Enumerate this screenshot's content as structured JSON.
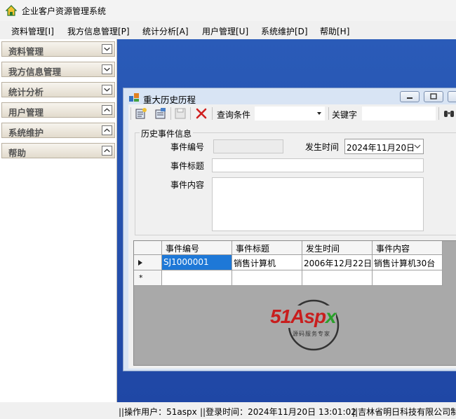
{
  "app": {
    "title": "企业客户资源管理系统"
  },
  "menu": [
    "资料管理[I]",
    "我方信息管理[P]",
    "统计分析[A]",
    "用户管理[U]",
    "系统维护[D]",
    "帮助[H]"
  ],
  "sidebar": {
    "items": [
      "资料管理",
      "我方信息管理",
      "统计分析",
      "用户管理",
      "系统维护",
      "帮助"
    ]
  },
  "window": {
    "title": "重大历史历程",
    "toolbar": {
      "query_label": "查询条件",
      "keyword_label": "关键字"
    },
    "group_title": "历史事件信息",
    "form": {
      "id_label": "事件编号",
      "time_label": "发生时间",
      "time_value": "2024年11月20日",
      "title_label": "事件标题",
      "content_label": "事件内容"
    },
    "grid": {
      "columns": [
        "事件编号",
        "事件标题",
        "发生时间",
        "事件内容"
      ],
      "rows": [
        [
          "SJ1000001",
          "销售计算机",
          "2006年12月22日",
          "销售计算机30台"
        ]
      ],
      "new_row_marker": "*"
    },
    "watermark": {
      "brand": "51Aspx",
      "tagline": "源码服务专家"
    }
  },
  "status": {
    "user": "||操作用户：51aspx",
    "login": "||登录时间：2024年11月20日 13:01:02",
    "company": "||吉林省明日科技有限公司制"
  },
  "colors": {
    "mdi_bg": "#2050b0",
    "selected_cell": "#1e78d7",
    "grid_bg": "#a9a9a9",
    "sidebar_item": "#e8e2d6"
  }
}
